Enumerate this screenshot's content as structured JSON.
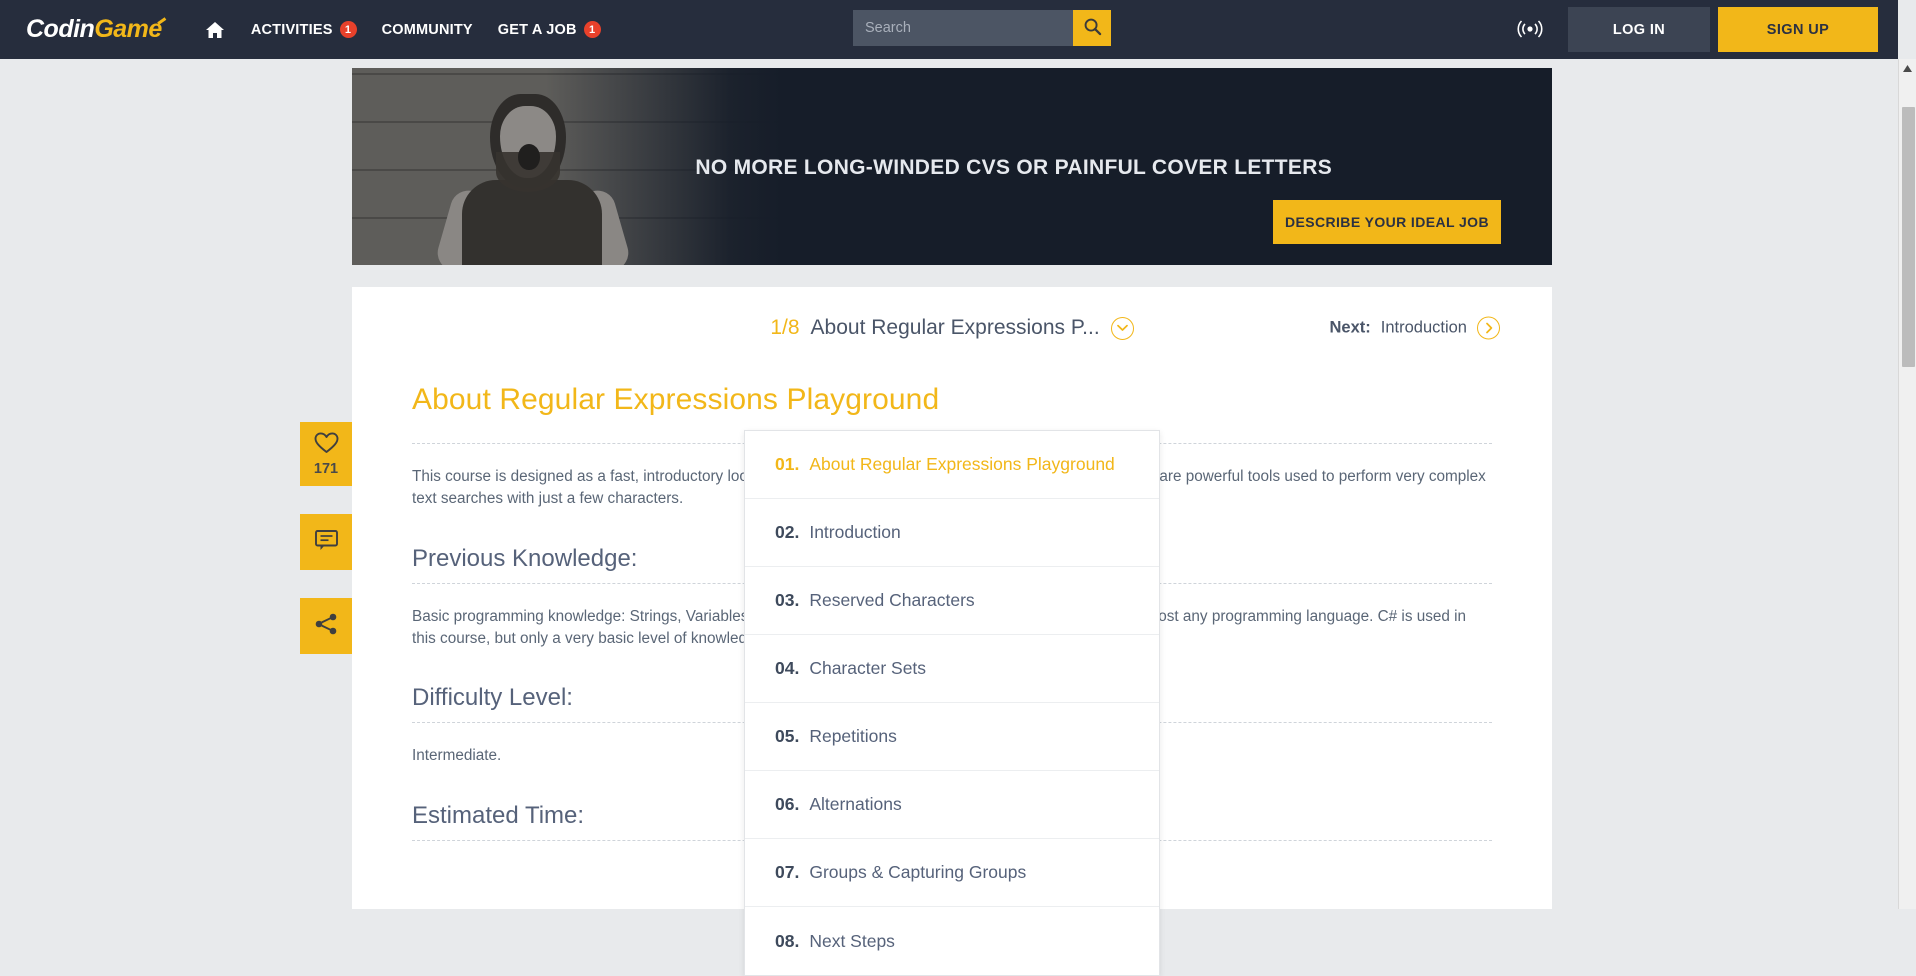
{
  "header": {
    "logo_text_1": "Codin",
    "logo_text_2": "Game",
    "home_icon": "home-icon",
    "nav": [
      {
        "label": "ACTIVITIES",
        "badge": "1"
      },
      {
        "label": "COMMUNITY",
        "badge": ""
      },
      {
        "label": "GET A JOB",
        "badge": "1"
      }
    ],
    "search": {
      "placeholder": "Search",
      "value": "",
      "icon": "search-icon"
    },
    "broadcast_icon": "broadcast-icon",
    "login_label": "LOG IN",
    "signup_label": "SIGN UP"
  },
  "banner": {
    "headline": "NO MORE LONG-WINDED CVS OR PAINFUL COVER LETTERS",
    "cta_label": "DESCRIBE YOUR IDEAL JOB"
  },
  "course_bar": {
    "progress": "1/8",
    "title": "About Regular Expressions P...",
    "dropdown_icon": "chevron-down-icon",
    "next_label": "Next:",
    "next_title": "Introduction",
    "next_icon": "chevron-right-icon"
  },
  "dropdown": {
    "items": [
      {
        "num": "01.",
        "label": "About Regular Expressions Playground",
        "active": true
      },
      {
        "num": "02.",
        "label": "Introduction",
        "active": false
      },
      {
        "num": "03.",
        "label": "Reserved Characters",
        "active": false
      },
      {
        "num": "04.",
        "label": "Character Sets",
        "active": false
      },
      {
        "num": "05.",
        "label": "Repetitions",
        "active": false
      },
      {
        "num": "06.",
        "label": "Alternations",
        "active": false
      },
      {
        "num": "07.",
        "label": "Groups & Capturing Groups",
        "active": false
      },
      {
        "num": "08.",
        "label": "Next Steps",
        "active": false
      }
    ]
  },
  "rail": {
    "like_icon": "heart-icon",
    "like_count": "171",
    "comment_icon": "comment-icon",
    "share_icon": "share-icon"
  },
  "article": {
    "title": "About Regular Expressions Playground",
    "intro": "This course is designed as a fast, introductory look at Regular Expressions. Regular Expressions (aka Regex) are powerful tools used to perform very complex text searches with just a few characters.",
    "sections": [
      {
        "heading": "Previous Knowledge:",
        "body": "Basic programming knowledge: Strings, Variables, Arrays and Loops. Regular Expressions can be used in almost any programming language. C# is used in this course, but only a very basic level of knowledge to complete the course."
      },
      {
        "heading": "Difficulty Level:",
        "body": "Intermediate."
      },
      {
        "heading": "Estimated Time:",
        "body": ""
      }
    ]
  },
  "colors": {
    "brand_yellow": "#f2b719",
    "nav_dark": "#262d3d",
    "badge_red": "#e8412b",
    "text_slate": "#5a6676"
  }
}
